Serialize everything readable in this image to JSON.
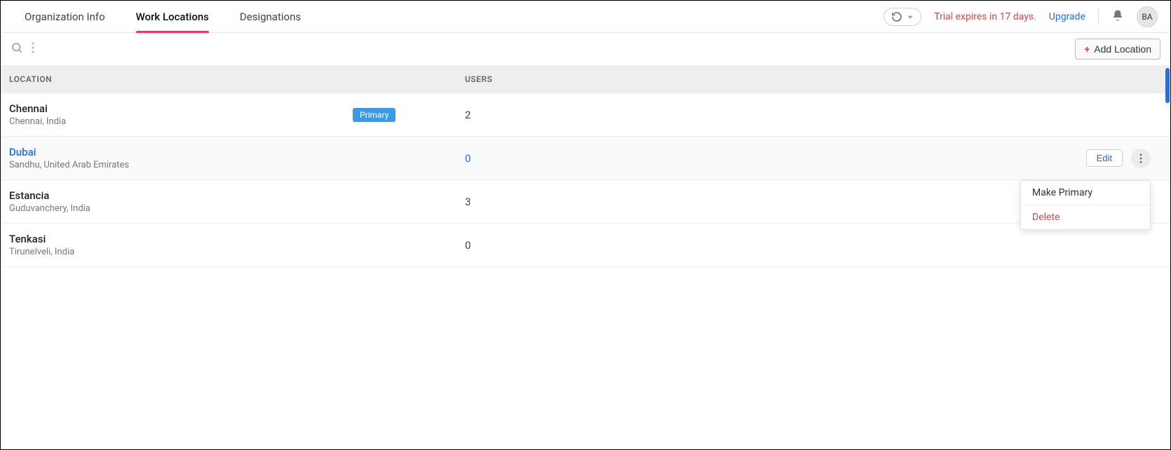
{
  "tabs": [
    {
      "label": "Organization Info",
      "active": false
    },
    {
      "label": "Work Locations",
      "active": true
    },
    {
      "label": "Designations",
      "active": false
    }
  ],
  "header": {
    "trial_text": "Trial expires in 17 days.",
    "upgrade_label": "Upgrade",
    "avatar_initials": "BA"
  },
  "toolbar": {
    "add_label": "Add Location"
  },
  "table": {
    "headers": {
      "location": "LOCATION",
      "users": "USERS"
    },
    "rows": [
      {
        "name": "Chennai",
        "sub": "Chennai, India",
        "primary": true,
        "primary_label": "Primary",
        "users": "2",
        "hovered": false
      },
      {
        "name": "Dubai",
        "sub": "Sandhu, United Arab Emirates",
        "primary": false,
        "users": "0",
        "hovered": true,
        "edit_label": "Edit"
      },
      {
        "name": "Estancia",
        "sub": "Guduvanchery, India",
        "primary": false,
        "users": "3",
        "hovered": false
      },
      {
        "name": "Tenkasi",
        "sub": "Tirunelveli, India",
        "primary": false,
        "users": "0",
        "hovered": false
      }
    ]
  },
  "dropdown": {
    "make_primary": "Make Primary",
    "delete": "Delete"
  }
}
